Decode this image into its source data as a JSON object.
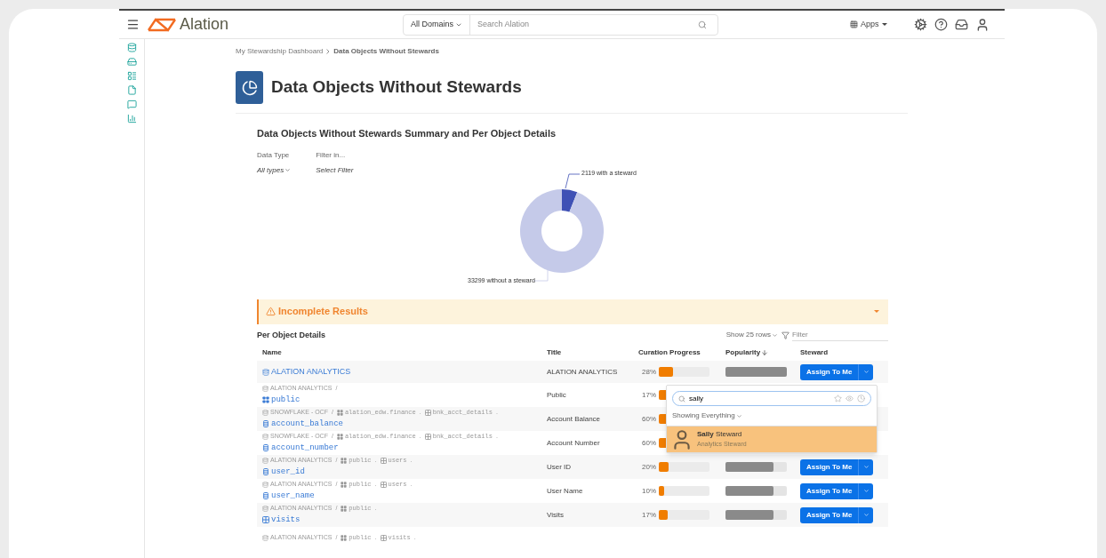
{
  "header": {
    "logo": "Alation",
    "domain_select": "All Domains",
    "search_placeholder": "Search Alation",
    "apps": "Apps"
  },
  "breadcrumb": [
    {
      "label": "My Stewardship Dashboard",
      "current": false
    },
    {
      "label": "Data Objects Without Stewards",
      "current": true
    }
  ],
  "page_title": "Data Objects Without Stewards",
  "section_title": "Data Objects Without Stewards Summary and Per Object Details",
  "filters": [
    {
      "label": "Data Type",
      "value": "All types",
      "dropdown": true
    },
    {
      "label": "Filter in...",
      "value": "Select Filter",
      "dropdown": false
    }
  ],
  "chart_data": {
    "type": "donut",
    "categories": [
      "with a steward",
      "without a steward"
    ],
    "values": [
      2119,
      33299
    ],
    "data_labels": true
  },
  "alert": {
    "title": "Incomplete Results",
    "expanded": false
  },
  "table": {
    "title": "Per Object Details",
    "rows_select": "Show 25 rows",
    "filter_placeholder": "Filter",
    "columns": [
      {
        "label": "Name",
        "sorted": false
      },
      {
        "label": "Title",
        "sorted": false
      },
      {
        "label": "Curation Progress",
        "sorted": false
      },
      {
        "label": "Popularity",
        "sorted": true
      },
      {
        "label": "Steward",
        "sorted": false
      }
    ],
    "rows": [
      {
        "path": [],
        "name": {
          "kind": "database",
          "text": "ALATION ANALYTICS"
        },
        "title": "ALATION ANALYTICS",
        "curation": {
          "reading": "28%",
          "level": 0.28
        },
        "popularity": {
          "level": 1
        },
        "steward_button": "Assign To Me"
      },
      {
        "path": [
          {
            "kind": "database",
            "text": "ALATION ANALYTICS",
            "sep": "/"
          }
        ],
        "name": {
          "kind": "schema",
          "text": "public"
        },
        "title": "Public",
        "curation": {
          "reading": "17%",
          "level": 0.17
        }
      },
      {
        "path": [
          {
            "kind": "database",
            "text": "SNOWFLAKE - OCF",
            "sep": "/"
          },
          {
            "kind": "schema",
            "text": "alation_edw.finance",
            "sep": "."
          },
          {
            "kind": "table",
            "text": "bnk_acct_details",
            "sep": "."
          }
        ],
        "name": {
          "kind": "column",
          "text": "account_balance"
        },
        "title": "Account Balance",
        "curation": {
          "reading": "60%",
          "level": 0.6
        }
      },
      {
        "path": [
          {
            "kind": "database",
            "text": "SNOWFLAKE - OCF",
            "sep": "/"
          },
          {
            "kind": "schema",
            "text": "alation_edw.finance",
            "sep": "."
          },
          {
            "kind": "table",
            "text": "bnk_acct_details",
            "sep": "."
          }
        ],
        "name": {
          "kind": "column",
          "text": "account_number"
        },
        "title": "Account Number",
        "curation": {
          "reading": "60%",
          "level": 0.6
        }
      },
      {
        "path": [
          {
            "kind": "database",
            "text": "ALATION ANALYTICS",
            "sep": "/"
          },
          {
            "kind": "schema",
            "text": "public",
            "sep": "."
          },
          {
            "kind": "table",
            "text": "users",
            "sep": "."
          }
        ],
        "name": {
          "kind": "column",
          "text": "user_id"
        },
        "title": "User ID",
        "curation": {
          "reading": "20%",
          "level": 0.2
        },
        "popularity": {
          "level": 0.78
        },
        "steward_button": "Assign To Me"
      },
      {
        "path": [
          {
            "kind": "database",
            "text": "ALATION ANALYTICS",
            "sep": "/"
          },
          {
            "kind": "schema",
            "text": "public",
            "sep": "."
          },
          {
            "kind": "table",
            "text": "users",
            "sep": "."
          }
        ],
        "name": {
          "kind": "column",
          "text": "user_name"
        },
        "title": "User Name",
        "curation": {
          "reading": "10%",
          "level": 0.1
        },
        "popularity": {
          "level": 0.78
        },
        "steward_button": "Assign To Me"
      },
      {
        "path": [
          {
            "kind": "database",
            "text": "ALATION ANALYTICS",
            "sep": "/"
          },
          {
            "kind": "schema",
            "text": "public",
            "sep": "."
          }
        ],
        "name": {
          "kind": "table",
          "text": "visits"
        },
        "title": "Visits",
        "curation": {
          "reading": "17%",
          "level": 0.17
        },
        "popularity": {
          "level": 0.78
        },
        "steward_button": "Assign To Me"
      },
      {
        "path": [
          {
            "kind": "database",
            "text": "ALATION ANALYTICS",
            "sep": "/"
          },
          {
            "kind": "schema",
            "text": "public",
            "sep": "."
          },
          {
            "kind": "table",
            "text": "visits",
            "sep": "."
          }
        ]
      }
    ]
  },
  "steward_dropdown": {
    "query": "sally",
    "scope": "Showing Everything",
    "results": [
      {
        "name": "**Sally** Steward",
        "role": "Analytics Steward",
        "selected": true
      }
    ]
  }
}
